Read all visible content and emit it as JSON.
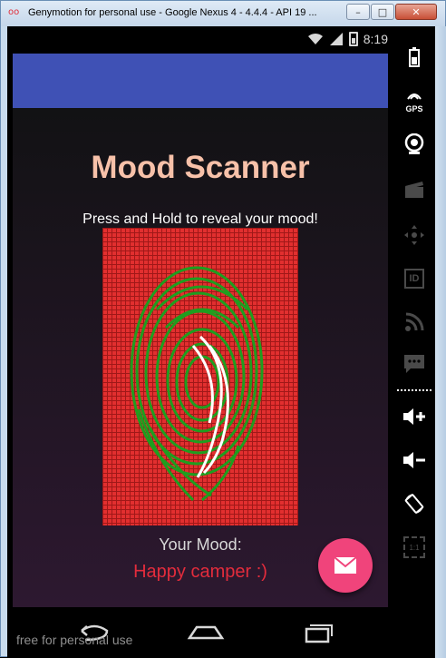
{
  "window": {
    "title": "Genymotion for personal use - Google Nexus 4 - 4.4.4 - API 19 ...",
    "icon": "genymotion-icon",
    "minimize_label": "–",
    "maximize_label": "□",
    "close_label": "✕"
  },
  "statusbar": {
    "time": "8:19"
  },
  "app": {
    "title": "Mood Scanner",
    "instruction": "Press and Hold to reveal your mood!",
    "mood_label": "Your Mood:",
    "mood_value": "Happy camper :)",
    "colors": {
      "appbar": "#3f51b5",
      "title": "#f7c1a9",
      "scanner_bg": "#e22f2f",
      "fingerprint": "#1f9e1f",
      "mood_value": "#e32c3c",
      "fab": "#f0447b"
    },
    "fab_icon": "mail-icon"
  },
  "sidebar": {
    "items": [
      "battery-icon",
      "gps-icon",
      "camera-icon",
      "clapperboard-icon",
      "dpad-icon",
      "id-icon",
      "rss-icon",
      "sms-icon",
      "volume-up-icon",
      "volume-down-icon",
      "rotate-icon",
      "scale-icon"
    ],
    "gps_label": "GPS",
    "id_label": "ID",
    "scale_label": "1:1"
  },
  "watermark": "free for personal use"
}
